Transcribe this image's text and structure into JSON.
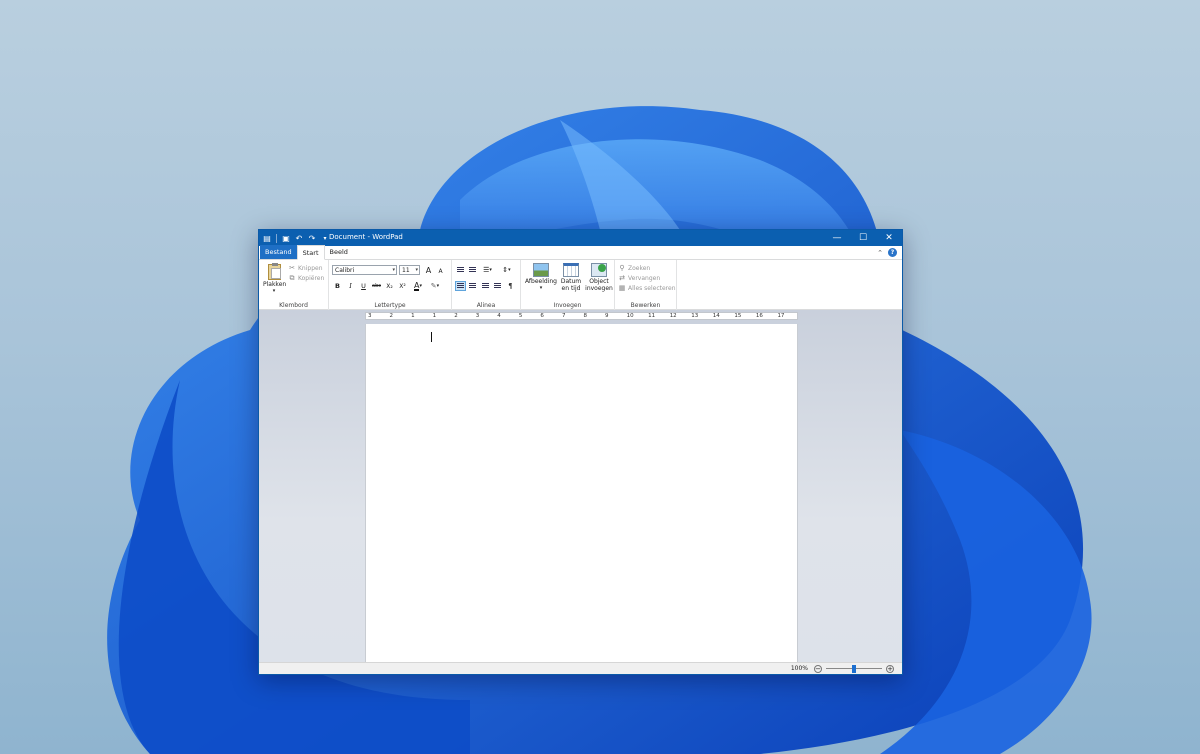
{
  "window": {
    "title": "Document - WordPad",
    "controls": {
      "minimize": "—",
      "maximize": "☐",
      "close": "✕"
    }
  },
  "qat": {
    "icons": [
      "wordpad-app-icon",
      "save-icon",
      "undo-icon",
      "redo-icon",
      "customize-qat-icon"
    ]
  },
  "tabs": [
    {
      "label": "Bestand"
    },
    {
      "label": "Start"
    },
    {
      "label": "Beeld"
    }
  ],
  "ribbon": {
    "clipboard": {
      "label": "Klembord",
      "paste": "Plakken",
      "cut": "Knippen",
      "copy": "Kopiëren"
    },
    "font": {
      "label": "Lettertype",
      "family": "Calibri",
      "size": "11",
      "bold": "B",
      "italic": "I",
      "underline": "U",
      "strike": "abc",
      "subscript": "X₂",
      "superscript": "X²",
      "grow": "A",
      "shrink": "A",
      "color": "A"
    },
    "paragraph": {
      "label": "Alinea"
    },
    "insert": {
      "label": "Invoegen",
      "picture": "Afbeelding",
      "datetime_1": "Datum",
      "datetime_2": "en tijd",
      "object_1": "Object",
      "object_2": "invoegen"
    },
    "editing": {
      "label": "Bewerken",
      "find": "Zoeken",
      "replace": "Vervangen",
      "select_all": "Alles selecteren"
    }
  },
  "ruler": {
    "labels": [
      "3",
      "2",
      "1",
      "1",
      "2",
      "3",
      "4",
      "5",
      "6",
      "7",
      "8",
      "9",
      "10",
      "11",
      "12",
      "13",
      "14",
      "15",
      "16",
      "17"
    ]
  },
  "status": {
    "zoom_label": "100%",
    "zoom_level": 0.5
  },
  "colors": {
    "titlebar": "#0b5fb0",
    "file_tab": "#1e6fc5",
    "accent": "#1c6fd0"
  }
}
